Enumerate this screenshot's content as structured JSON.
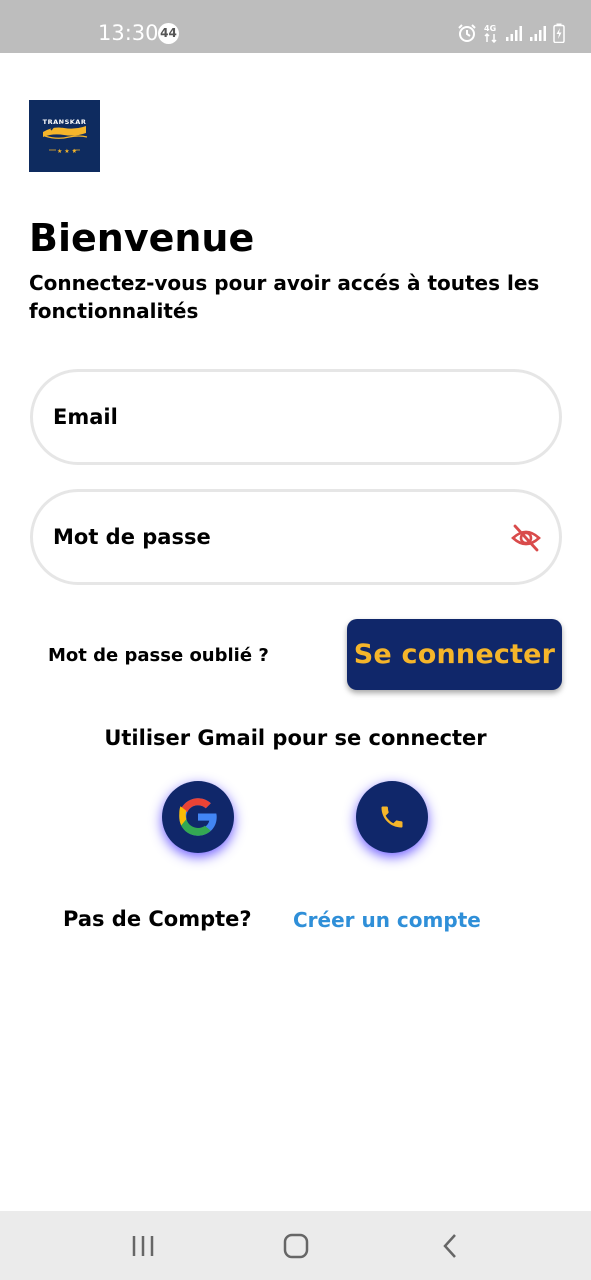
{
  "status_bar": {
    "time": "13:30",
    "notification_count": "44",
    "network": "4G"
  },
  "logo": {
    "text": "TRANSKAR"
  },
  "header": {
    "title": "Bienvenue",
    "subtitle": "Connectez-vous pour avoir accés à toutes les fonctionnalités"
  },
  "form": {
    "email_placeholder": "Email",
    "password_placeholder": "Mot de passe"
  },
  "actions": {
    "forgot_password": "Mot de passe oublié ?",
    "login_label": "Se connecter",
    "alt_login_label": "Utiliser Gmail pour se connecter"
  },
  "signup": {
    "prompt": "Pas de Compte?",
    "link": "Créer un compte"
  },
  "colors": {
    "primary": "#10276a",
    "accent": "#f5b52a",
    "link": "#2f8fd8",
    "eye_icon": "#d94b4b"
  },
  "icons": {
    "password_toggle": "eye-off-icon",
    "google": "google-icon",
    "phone": "phone-icon"
  }
}
